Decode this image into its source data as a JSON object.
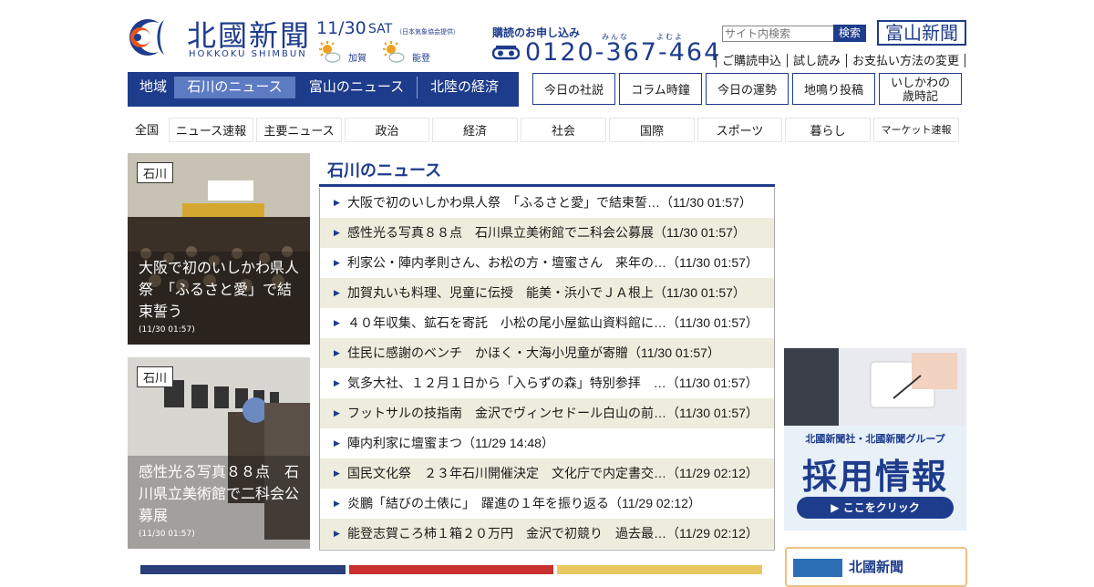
{
  "header": {
    "logo_jp": "北國新聞",
    "logo_en": "HOKKOKU SHIMBUN",
    "date": "11/30",
    "day_of_week": "SAT",
    "weather_credit": "（日本気象協会提供）",
    "weather": [
      {
        "region": "加賀",
        "icon": "sun-cloud-icon"
      },
      {
        "region": "能登",
        "icon": "sun-cloud-icon"
      }
    ],
    "subscribe_label": "購読のお申し込み",
    "phone_ruby": "みんな　　　よむよ",
    "phone": "0120-367-464",
    "search_placeholder": "サイト内検索",
    "search_button": "検索",
    "toyama_button": "富山新聞",
    "links": [
      "ご購読申込",
      "試し読み",
      "お支払い方法の変更"
    ]
  },
  "region_nav": {
    "label": "地域",
    "items": [
      "石川のニュース",
      "富山のニュース",
      "北陸の経済"
    ],
    "active": "石川のニュース"
  },
  "column_buttons": [
    "今日の社説",
    "コラム時鐘",
    "今日の運勢",
    "地鳴り投稿",
    "いしかわの\n歳時記"
  ],
  "category_nav": [
    "全国",
    "ニュース速報",
    "主要ニュース",
    "政治",
    "経済",
    "社会",
    "国際",
    "スポーツ",
    "暮らし",
    "マーケット速報"
  ],
  "featured": [
    {
      "tag": "石川",
      "caption": "大阪で初のいしかわ県人祭　「ふるさと愛」で結束誓う",
      "time": "(11/30 01:57)"
    },
    {
      "tag": "石川",
      "caption": "感性光る写真８８点　石川県立美術館で二科会公募展",
      "time": "(11/30 01:57)"
    }
  ],
  "news": {
    "title": "石川のニュース",
    "items": [
      "大阪で初のいしかわ県人祭　「ふるさと愛」で結束誓…（11/30 01:57）",
      "感性光る写真８８点　石川県立美術館で二科会公募展（11/30 01:57）",
      "利家公・陣内孝則さん、お松の方・壇蜜さん　来年の…（11/30 01:57）",
      "加賀丸いも料理、児童に伝授　能美・浜小でＪＡ根上（11/30 01:57）",
      "４０年収集、鉱石を寄託　小松の尾小屋鉱山資料館に…（11/30 01:57）",
      "住民に感謝のベンチ　かほく・大海小児童が寄贈（11/30 01:57）",
      "気多大社、１２月１日から「入らずの森」特別参拝　…（11/30 01:57）",
      "フットサルの技指南　金沢でヴィンセドール白山の前…（11/30 01:57）",
      "陣内利家に壇蜜まつ（11/29 14:48）",
      "国民文化祭　２３年石川開催決定　文化庁で内定書交…（11/29 02:12）",
      "炎鵬「結びの土俵に」　躍進の１年を振り返る（11/29 02:12）",
      "能登志賀ころ柿１箱２０万円　金沢で初競り　過去最…（11/29 02:12）"
    ]
  },
  "ad": {
    "company": "北國新聞社・北國新聞グループ",
    "headline": "採用情報",
    "cta": "▶ ここをクリック"
  },
  "ad_bottom": {
    "text": "北國新聞"
  },
  "colors": {
    "brand": "#1e3c8c",
    "active_nav": "#5d7bc2",
    "row_alt": "#eeecdc"
  }
}
